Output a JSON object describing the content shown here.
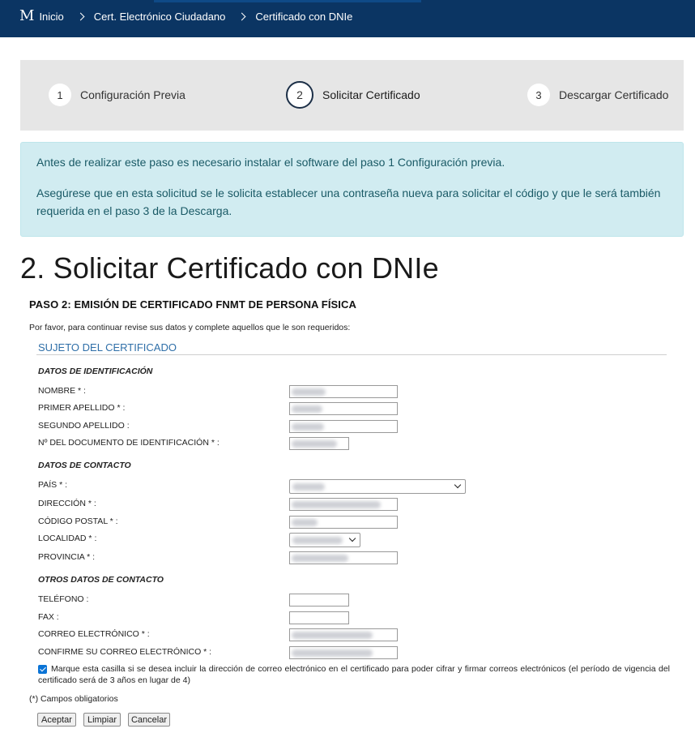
{
  "header": {
    "logo": "M",
    "breadcrumbs": [
      "Inicio",
      "Cert. Electrónico Ciudadano",
      "Certificado con DNIe"
    ]
  },
  "steps": [
    {
      "num": "1",
      "label": "Configuración Previa"
    },
    {
      "num": "2",
      "label": "Solicitar Certificado"
    },
    {
      "num": "3",
      "label": "Descargar Certificado"
    }
  ],
  "alert": {
    "p1": "Antes de realizar este paso es necesario instalar el software del paso 1 Configuración previa.",
    "p2": "Asegúrese que en esta solicitud se le solicita establecer una contraseña nueva para solicitar el código y que le será también requerida en el paso 3 de la Descarga."
  },
  "page_title": "2. Solicitar Certificado con DNIe",
  "form": {
    "paso": "PASO 2: EMISIÓN DE CERTIFICADO FNMT DE PERSONA FÍSICA",
    "intro": "Por favor, para continuar revise sus datos y complete aquellos que le son requeridos:",
    "section": "SUJETO DEL CERTIFICADO",
    "groups": {
      "ident": "DATOS DE IDENTIFICACIÓN",
      "contacto": "DATOS DE CONTACTO",
      "otros": "OTROS DATOS DE CONTACTO"
    },
    "labels": {
      "nombre": "NOMBRE * :",
      "apellido1": "PRIMER APELLIDO * :",
      "apellido2": "SEGUNDO APELLIDO :",
      "documento": "Nº DEL DOCUMENTO DE IDENTIFICACIÓN * :",
      "pais": "PAÍS * :",
      "direccion": "DIRECCIÓN * :",
      "cp": "CÓDIGO POSTAL * :",
      "localidad": "LOCALIDAD * :",
      "provincia": "PROVINCIA * :",
      "telefono": "TELÉFONO :",
      "fax": "FAX :",
      "correo": "CORREO ELECTRÓNICO * :",
      "correo2": "CONFIRME SU CORREO ELECTRÓNICO * :"
    },
    "checkbox": {
      "checked": true,
      "text": "Marque esta casilla si se desea incluir la dirección de correo electrónico en el certificado para poder cifrar y firmar correos electrónicos (el período de vigencia del certificado será de 3 años en lugar de 4)"
    },
    "required_note": "(*) Campos obligatorios",
    "buttons": {
      "accept": "Aceptar",
      "clear": "Limpiar",
      "cancel": "Cancelar"
    }
  },
  "colors": {
    "header_bg": "#0b3563",
    "steps_bg": "#e6e6e6",
    "alert_bg": "#d1ecf1",
    "section_title": "#2f6fa8",
    "checkbox": "#0b74d6"
  }
}
